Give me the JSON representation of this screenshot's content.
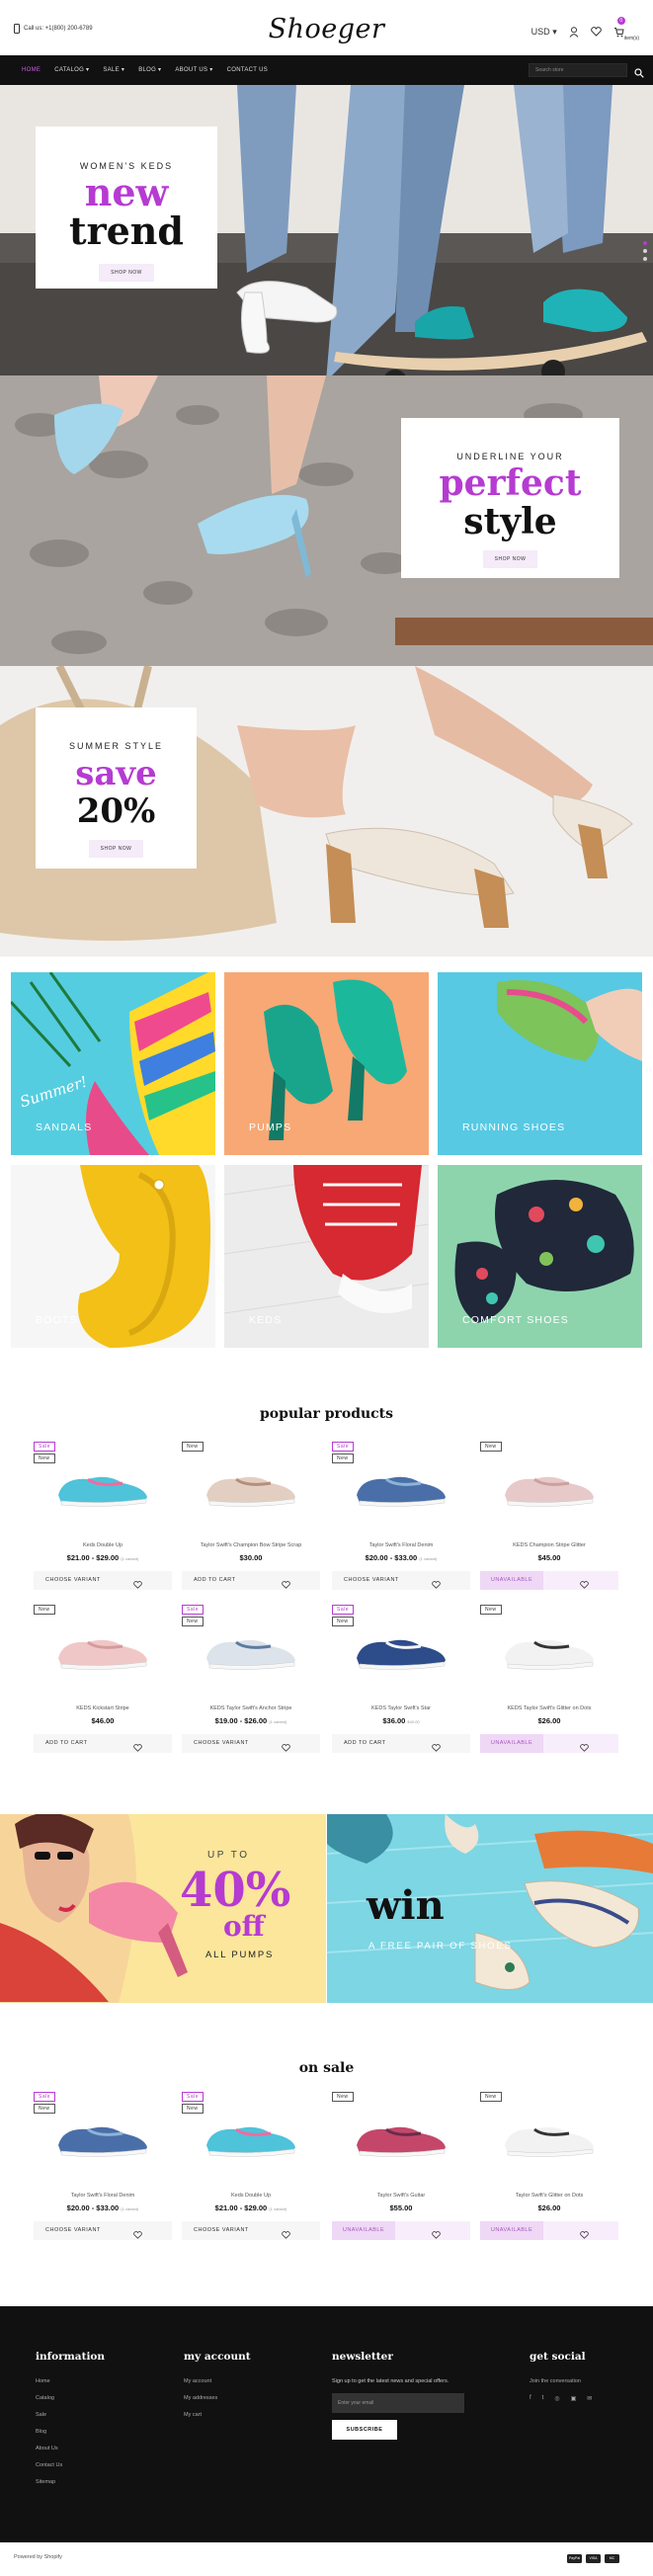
{
  "header": {
    "phone": "Call us: +1(800) 200-6789",
    "logo": "Shoeger",
    "currency": "USD",
    "cart_count": "0",
    "cart_label": "item(s)"
  },
  "menu": {
    "items": [
      {
        "label": "Home",
        "active": true
      },
      {
        "label": "Catalog ▾"
      },
      {
        "label": "Sale ▾"
      },
      {
        "label": "Blog ▾"
      },
      {
        "label": "About us ▾"
      },
      {
        "label": "Contact us"
      }
    ],
    "search_placeholder": "Search store"
  },
  "slides": [
    {
      "pre": "Women's Keds",
      "line1": "new",
      "line2": "trend",
      "button": "Shop now"
    },
    {
      "pre": "Underline your",
      "line1": "perfect",
      "line2": "style",
      "button": "Shop now"
    },
    {
      "pre": "Summer style",
      "line1": "save",
      "line2": "20%",
      "button": "Shop now"
    }
  ],
  "categories": [
    {
      "label": "Sandals",
      "script": "Summer!"
    },
    {
      "label": "Pumps"
    },
    {
      "label": "Running shoes"
    },
    {
      "label": "Boots"
    },
    {
      "label": "Keds"
    },
    {
      "label": "Comfort shoes"
    }
  ],
  "popular": {
    "title": "popular products",
    "products": [
      {
        "badges": [
          "Sale",
          "New"
        ],
        "name": "Keds Double Up",
        "price": "$21.00 - $29.00",
        "unit": "(1 variant)",
        "action": "Choose variant",
        "type": "var"
      },
      {
        "badges": [
          "New"
        ],
        "name": "Taylor Swift's Champion Bow Stripe Scrap",
        "price": "$30.00",
        "unit": "",
        "action": "Add to cart",
        "type": "add"
      },
      {
        "badges": [
          "Sale",
          "New"
        ],
        "name": "Taylor Swift's Floral Denim",
        "price": "$20.00 - $33.00",
        "unit": "(1 variant)",
        "action": "Choose variant",
        "type": "var"
      },
      {
        "badges": [
          "New"
        ],
        "name": "KEDS Champion Stripe Glitter",
        "price": "$45.00",
        "unit": "",
        "action": "Unavailable",
        "type": "un"
      },
      {
        "badges": [
          "New"
        ],
        "name": "KEDS Kickstart Stripe",
        "price": "$46.00",
        "unit": "",
        "action": "Add to cart",
        "type": "add"
      },
      {
        "badges": [
          "Sale",
          "New"
        ],
        "name": "KEDS Taylor Swift's Anchor Stripe",
        "price": "$19.00 - $26.00",
        "unit": "(1 variant)",
        "action": "Choose variant",
        "type": "var"
      },
      {
        "badges": [
          "Sale",
          "New"
        ],
        "name": "KEDS Taylor Swift's Star",
        "price": "$36.00",
        "unit": "$40.00",
        "action": "Add to cart",
        "type": "add"
      },
      {
        "badges": [
          "New"
        ],
        "name": "KEDS Taylor Swift's Glitter on Dots",
        "price": "$26.00",
        "unit": "",
        "action": "Unavailable",
        "type": "un"
      }
    ]
  },
  "banners": {
    "left": {
      "up": "Up to",
      "big": "40%",
      "off": "off",
      "sub": "All pumps"
    },
    "right": {
      "big": "win",
      "sub": "A free pair of shoes"
    }
  },
  "onsale": {
    "title": "on sale",
    "products": [
      {
        "badges": [
          "Sale",
          "New"
        ],
        "name": "Taylor Swift's Floral Denim",
        "price": "$20.00 - $33.00",
        "unit": "(1 variant)",
        "action": "Choose variant",
        "type": "var"
      },
      {
        "badges": [
          "Sale",
          "New"
        ],
        "name": "Keds Double Up",
        "price": "$21.00 - $29.00",
        "unit": "(1 variant)",
        "action": "Choose variant",
        "type": "var"
      },
      {
        "badges": [
          "New"
        ],
        "name": "Taylor Swift's Guitar",
        "price": "$55.00",
        "unit": "",
        "action": "Unavailable",
        "type": "un"
      },
      {
        "badges": [
          "New"
        ],
        "name": "Taylor Swift's Glitter on Dots",
        "price": "$26.00",
        "unit": "",
        "action": "Unavailable",
        "type": "un"
      }
    ]
  },
  "footer": {
    "information": {
      "title": "information",
      "links": [
        "Home",
        "Catalog",
        "Sale",
        "Blog",
        "About Us",
        "Contact Us",
        "Sitemap"
      ]
    },
    "account": {
      "title": "my account",
      "links": [
        "My account",
        "My addresses",
        "My cart"
      ]
    },
    "newsletter": {
      "title": "newsletter",
      "text": "Sign up to get the latest news and special offers.",
      "placeholder": "Enter your email",
      "button": "Subscribe"
    },
    "social": {
      "title": "get social",
      "text": "Join the conversation",
      "icons": [
        "f",
        "t",
        "◎",
        "▣",
        "✉"
      ]
    },
    "powered": "Powered by Shopify",
    "payments": [
      "PayPal",
      "VISA",
      "MC"
    ]
  },
  "colors": {
    "accent": "#b63bd1",
    "dark": "#111111"
  }
}
